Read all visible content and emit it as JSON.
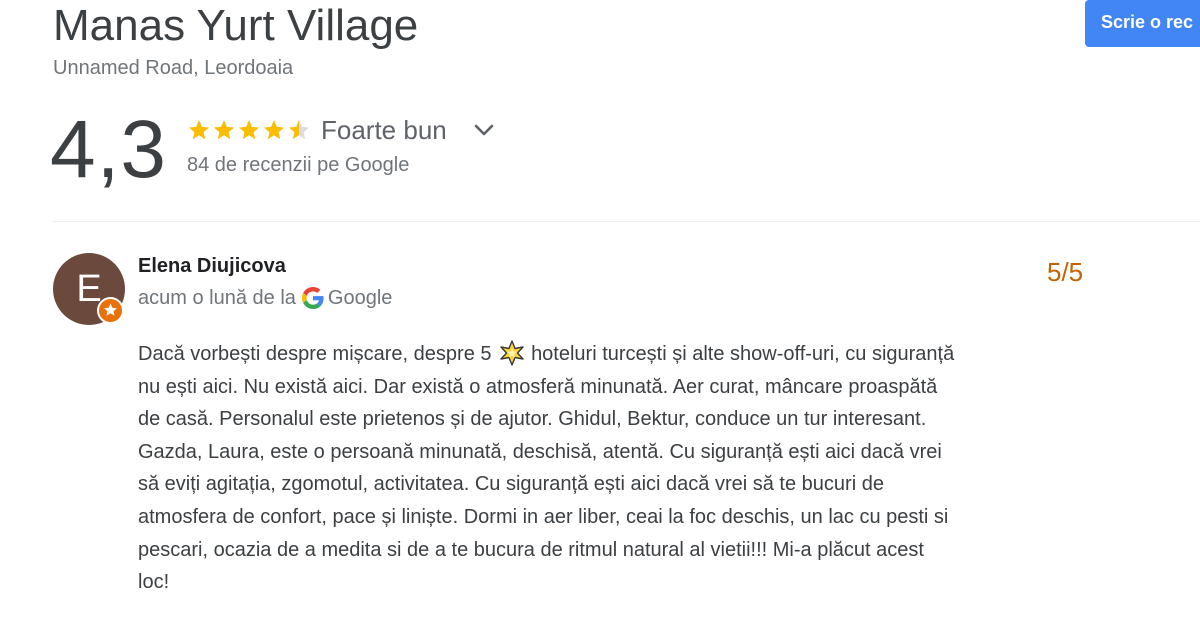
{
  "place": {
    "title": "Manas Yurt Village",
    "address": "Unnamed Road, Leordoaia"
  },
  "header": {
    "write_review_label": "Scrie o rec"
  },
  "rating": {
    "value_text": "4,3",
    "stars_value": 4.3,
    "stars_max": 5,
    "label": "Foarte bun",
    "review_count_text": "84 de recenzii pe Google"
  },
  "review": {
    "avatar_letter": "E",
    "reviewer_name": "Elena Diujicova",
    "time_text": "acum o lună de la",
    "source_text": "Google",
    "score_text": "5/5",
    "text_lines": [
      "Dacă vorbești despre mișcare, despre 5",
      "hoteluri turcești și alte show-off-uri, cu siguranță",
      "nu ești aici. Nu există aici. Dar există o atmosferă minunată. Aer curat, mâncare proaspătă",
      "de casă. Personalul este prietenos și de ajutor. Ghidul, Bektur, conduce un tur interesant.",
      "Gazda, Laura, este o persoană minunată, deschisă, atentă. Cu siguranță ești aici dacă vrei",
      "să eviți agitația, zgomotul, activitatea. Cu siguranță ești aici dacă vrei să te bucuri de",
      "atmosfera de confort, pace și liniște. Dormi in aer liber, ceai la foc deschis, un lac cu pesti si",
      "pescari, ocazia de a medita si de a te bucura de ritmul natural al vietii!!! Mi-a plăcut acest",
      "loc!"
    ]
  },
  "colors": {
    "star_gold": "#fbbc04",
    "star_empty": "#dadce0",
    "score_orange": "#c26401",
    "button_blue": "#4285f4",
    "avatar_brown": "#6b4a3d",
    "badge_orange": "#e8710a"
  },
  "icons": {
    "rating_stars": "star-icon",
    "dropdown": "chevron-down-icon",
    "local_guide_badge": "local-guide-badge-icon",
    "source_logo": "google-g-icon",
    "inline_emoji": "glowing-star-emoji-icon"
  }
}
